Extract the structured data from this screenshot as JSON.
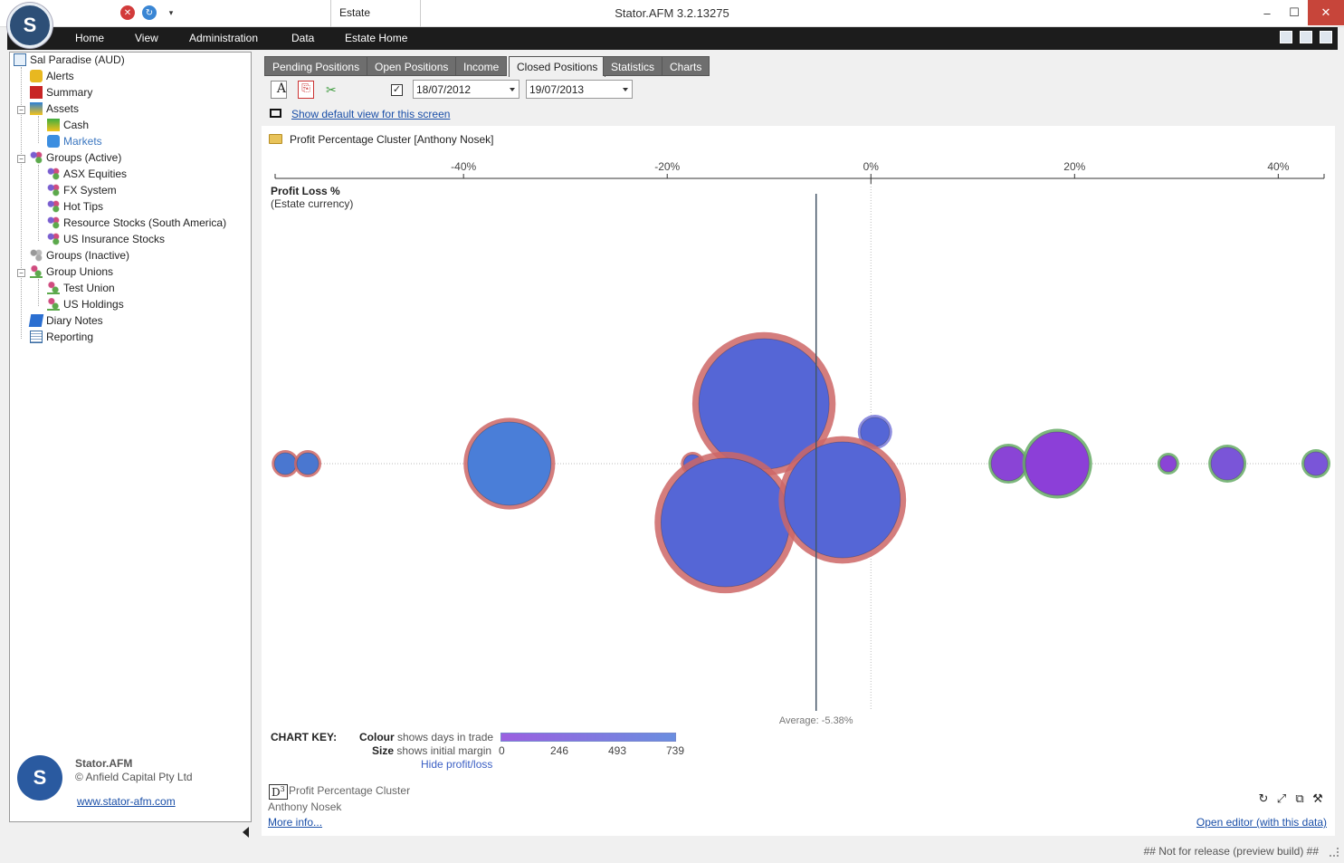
{
  "window": {
    "title": "Stator.AFM 3.2.13275",
    "estate_tab": "Estate",
    "controls": {
      "minimize": "–",
      "maximize": "☐",
      "close": "✕"
    }
  },
  "menu": {
    "items": [
      "Home",
      "View",
      "Administration",
      "Data",
      "Estate Home"
    ]
  },
  "sidebar": {
    "root": "Sal Paradise (AUD)",
    "items": [
      {
        "label": "Alerts",
        "icon": "bell-icon"
      },
      {
        "label": "Summary",
        "icon": "summary-icon"
      },
      {
        "label": "Assets",
        "icon": "assets-icon"
      },
      {
        "label": "Cash",
        "icon": "cash-icon"
      },
      {
        "label": "Markets",
        "icon": "markets-icon"
      },
      {
        "label": "Groups (Active)",
        "icon": "group-icon"
      },
      {
        "label": "ASX Equities",
        "icon": "group-icon"
      },
      {
        "label": "FX System",
        "icon": "group-icon"
      },
      {
        "label": "Hot Tips",
        "icon": "group-icon"
      },
      {
        "label": "Resource Stocks (South America)",
        "icon": "group-icon"
      },
      {
        "label": "US Insurance Stocks",
        "icon": "group-icon"
      },
      {
        "label": "Groups (Inactive)",
        "icon": "group-icon"
      },
      {
        "label": "Group Unions",
        "icon": "union-icon"
      },
      {
        "label": "Test Union",
        "icon": "union-icon"
      },
      {
        "label": "US Holdings",
        "icon": "union-icon"
      },
      {
        "label": "Diary Notes",
        "icon": "diary-icon"
      },
      {
        "label": "Reporting",
        "icon": "report-icon"
      }
    ],
    "brand_name": "Stator.AFM",
    "brand_copyright": "© Anfield Capital Pty Ltd",
    "brand_url": "www.stator-afm.com"
  },
  "tabs": [
    "Pending Positions",
    "Open Positions",
    "Income",
    "Closed Positions",
    "Statistics",
    "Charts"
  ],
  "active_tab": "Closed Positions",
  "toolbar": {
    "date_from": "18/07/2012",
    "date_to": "19/07/2013",
    "checkbox_checked": true,
    "default_view_link": "Show default view for this screen"
  },
  "content": {
    "breadcrumb": "Profit Percentage Cluster [Anthony Nosek]",
    "footer_title": "Profit Percentage Cluster",
    "footer_author": "Anthony Nosek",
    "footer_more": "More info...",
    "footer_editor": "Open editor (with this data)",
    "d3_label": "D"
  },
  "chart_data": {
    "type": "scatter",
    "title": "Profit Loss %",
    "subtitle": "(Estate currency)",
    "x_ticks": [
      "-40%",
      "-20%",
      "0%",
      "20%",
      "40%"
    ],
    "x_tick_values": [
      -40,
      -20,
      0,
      20,
      40
    ],
    "xlim": [
      -58.5,
      44.5
    ],
    "average_label": "Average: -5.38%",
    "average_value": -5.38,
    "bubbles": [
      {
        "x": -57.5,
        "y": 0,
        "r": 12,
        "fill": "#4a77d0",
        "ring": "#cc6666"
      },
      {
        "x": -55.3,
        "y": 0,
        "r": 12,
        "fill": "#4a77d0",
        "ring": "#cc6666"
      },
      {
        "x": -35.5,
        "y": 0,
        "r": 46,
        "fill": "#4a7ed8",
        "ring": "#cc6666"
      },
      {
        "x": -17.5,
        "y": 0,
        "r": 10,
        "fill": "#5566d6",
        "ring": "#cc6666"
      },
      {
        "x": -10.5,
        "y": 66,
        "r": 72,
        "fill": "#5566d6",
        "ring": "#cc6666"
      },
      {
        "x": 0.4,
        "y": 35,
        "r": 16,
        "fill": "#5566d6",
        "ring": "#7a7adb"
      },
      {
        "x": -14.3,
        "y": -65,
        "r": 71,
        "fill": "#5566d6",
        "ring": "#cc6666"
      },
      {
        "x": -2.8,
        "y": -40,
        "r": 64,
        "fill": "#5566d6",
        "ring": "#cc6666"
      },
      {
        "x": 13.5,
        "y": 0,
        "r": 19,
        "fill": "#8a44d6",
        "ring": "#66aa66"
      },
      {
        "x": 18.3,
        "y": 0,
        "r": 35,
        "fill": "#8c3fd8",
        "ring": "#66aa66"
      },
      {
        "x": 29.2,
        "y": 0,
        "r": 9,
        "fill": "#8a44d6",
        "ring": "#66aa66"
      },
      {
        "x": 35.0,
        "y": 0,
        "r": 18,
        "fill": "#7a55d8",
        "ring": "#66aa66"
      },
      {
        "x": 43.7,
        "y": 0,
        "r": 13,
        "fill": "#7a55d8",
        "ring": "#66aa66"
      }
    ],
    "key": {
      "label": "CHART KEY:",
      "colour_bold": "Colour",
      "colour_text": " shows days in trade",
      "size_bold": "Size",
      "size_text": " shows initial margin",
      "ticks": [
        "0",
        "246",
        "493",
        "739"
      ],
      "hide_link": "Hide profit/loss"
    }
  },
  "status": {
    "text": "## Not for release (preview build) ##"
  }
}
